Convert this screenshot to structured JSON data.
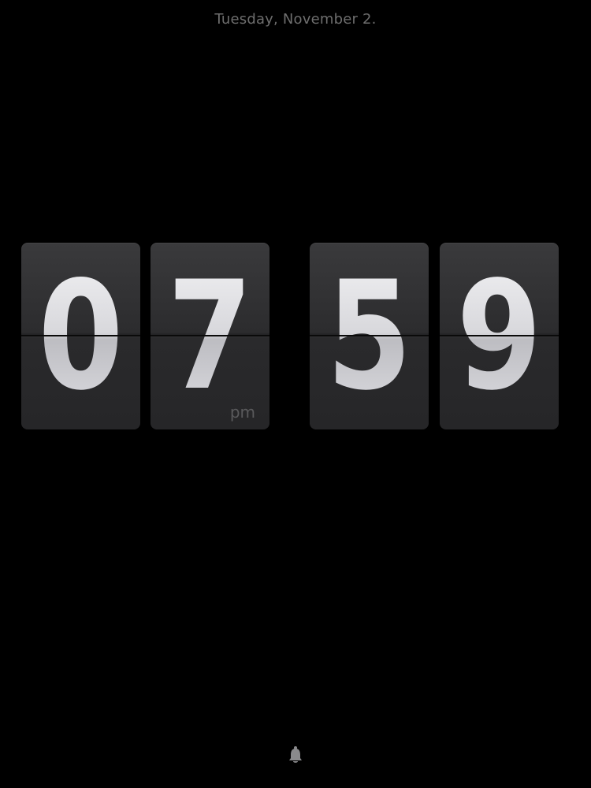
{
  "status": {
    "date": "Tuesday, November 2."
  },
  "clock": {
    "digits": [
      "0",
      "7",
      "5",
      "9"
    ],
    "period": "pm"
  },
  "alarm": {
    "icon": "bell-icon"
  },
  "colors": {
    "background": "#000000",
    "card": "#2c2c2e",
    "digit": "#e4e4e6",
    "muted_text": "#6e6e6e"
  }
}
